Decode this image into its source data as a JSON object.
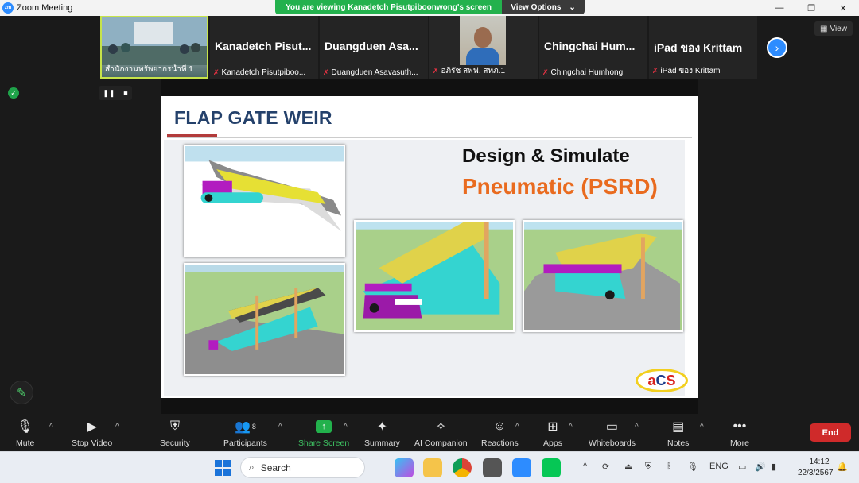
{
  "window": {
    "title": "Zoom Meeting",
    "logo": "zm",
    "controls": [
      "—",
      "❐",
      "✕"
    ]
  },
  "banner": {
    "message": "You are viewing Kanadetch Pisutpiboonwong's screen",
    "options_label": "View Options"
  },
  "gallery": [
    {
      "big": "",
      "small": "สำนักงานทรัพยากรน้ำที่ 1",
      "muted": false
    },
    {
      "big": "Kanadetch  Pisut...",
      "small": "Kanadetch Pisutpiboo...",
      "muted": true
    },
    {
      "big": "Duangduen  Asa...",
      "small": "Duangduen Asavasuth...",
      "muted": true
    },
    {
      "big": "",
      "small": "อภิรัช สพฟ. สทภ.1",
      "muted": true
    },
    {
      "big": "Chingchai  Hum...",
      "small": "Chingchai Humhong",
      "muted": true
    },
    {
      "big": "iPad ของ Krittam",
      "small": "iPad ของ Krittam",
      "muted": true
    }
  ],
  "view_button": "View",
  "slide": {
    "title": "FLAP GATE WEIR",
    "heading1": "Design & Simulate",
    "heading2": "Pneumatic (PSRD)",
    "logo": {
      "a": "a",
      "c": "C",
      "s": "S"
    }
  },
  "toolbar": {
    "mute": "Mute",
    "stop_video": "Stop Video",
    "security": "Security",
    "participants": "Participants",
    "participants_count": "8",
    "share_screen": "Share Screen",
    "summary": "Summary",
    "ai_companion": "AI Companion",
    "reactions": "Reactions",
    "apps": "Apps",
    "whiteboards": "Whiteboards",
    "notes": "Notes",
    "more": "More",
    "end": "End"
  },
  "taskbar": {
    "search_placeholder": "Search",
    "language": "ENG",
    "time": "14:12",
    "date": "22/3/2567"
  }
}
